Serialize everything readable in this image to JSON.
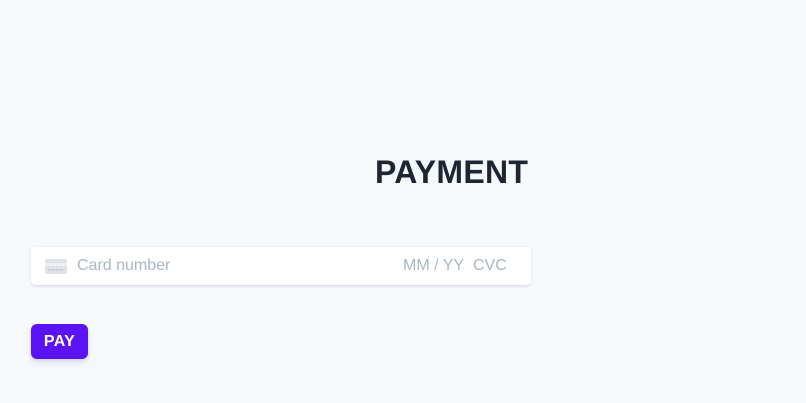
{
  "header": {
    "title": "PAYMENT"
  },
  "card_form": {
    "card_icon": "credit-card-icon",
    "card_number_placeholder": "Card number",
    "expiry_placeholder": "MM / YY",
    "cvc_placeholder": "CVC"
  },
  "actions": {
    "pay_label": "PAY"
  },
  "colors": {
    "background": "#f6f9fc",
    "title": "#1f2533",
    "placeholder": "#aab7c4",
    "accent": "#5b12f5"
  }
}
